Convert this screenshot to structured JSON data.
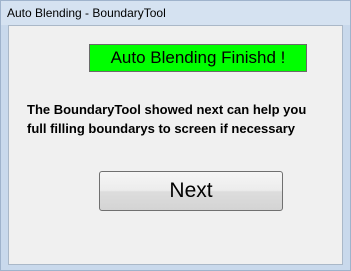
{
  "window": {
    "title": "Auto Blending - BoundaryTool"
  },
  "banner": {
    "text": "Auto Blending Finishd !",
    "background_color": "#00ff00"
  },
  "message": {
    "line1": "The BoundaryTool showed next can help you",
    "line2": "full filling boundarys to screen if necessary"
  },
  "buttons": {
    "next_label": "Next"
  }
}
